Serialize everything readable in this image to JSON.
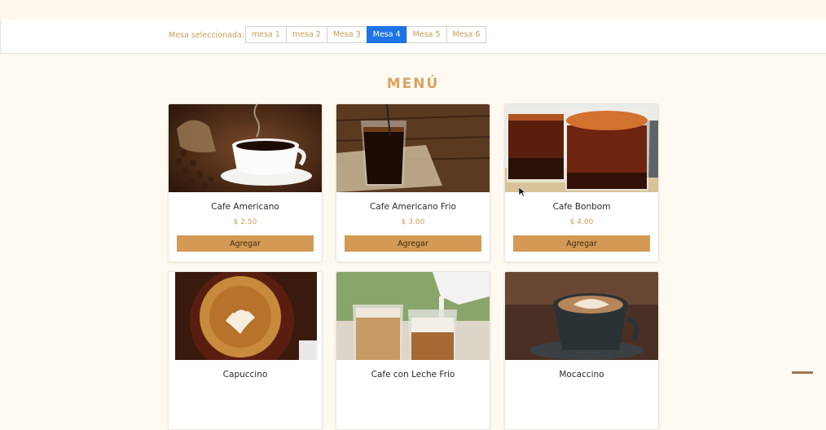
{
  "table_selector": {
    "label": "Mesa seleccionada:",
    "tables": [
      "mesa 1",
      "mesa 2",
      "Mesa 3",
      "Mesa 4",
      "Mesa 5",
      "Mesa 6"
    ],
    "active_index": 3
  },
  "menu": {
    "title": "MENÚ",
    "items": [
      {
        "name": "Cafe Americano",
        "price": "$ 2.50",
        "button": "Agregar"
      },
      {
        "name": "Cafe Americano Frio",
        "price": "$ 3.00",
        "button": "Agregar"
      },
      {
        "name": "Cafe Bonbom",
        "price": "$ 4.00",
        "button": "Agregar"
      },
      {
        "name": "Capuccino",
        "price": "",
        "button": ""
      },
      {
        "name": "Cafe con Leche Frio",
        "price": "",
        "button": ""
      },
      {
        "name": "Mocaccino",
        "price": "",
        "button": ""
      }
    ]
  },
  "colors": {
    "accent": "#d49a55",
    "active_tab": "#1d74e6",
    "title": "#d9a360"
  }
}
